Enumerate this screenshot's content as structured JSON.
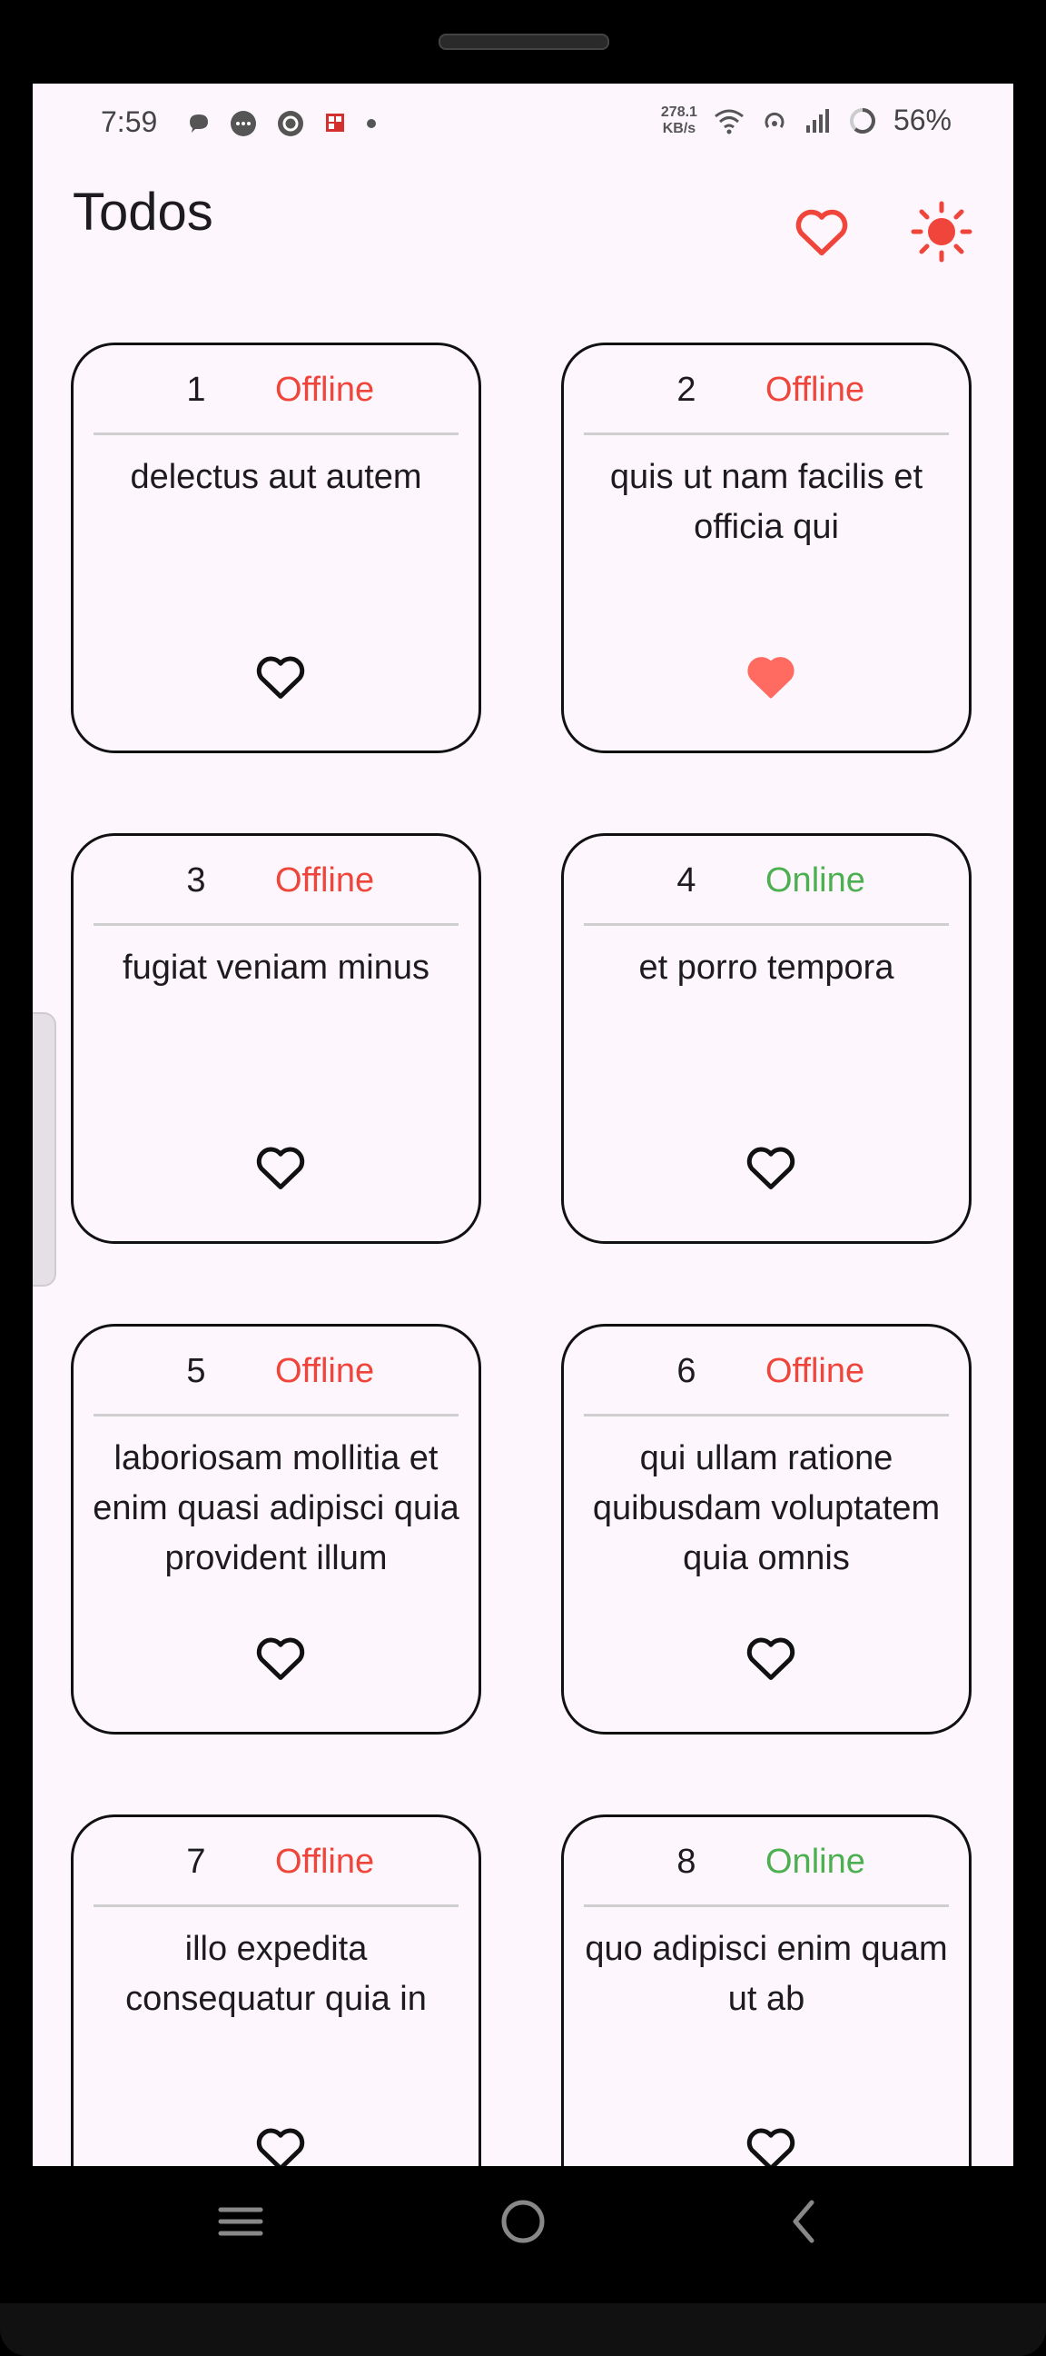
{
  "status_bar": {
    "time": "7:59",
    "network_speed_value": "278.1",
    "network_speed_unit": "KB/s",
    "battery": "56%"
  },
  "app_bar": {
    "title": "Todos",
    "favorites_icon": "heart-outline-icon",
    "theme_icon": "sun-icon"
  },
  "colors": {
    "accent": "#f0453a",
    "offline": "#f0453a",
    "online": "#4caf50",
    "favorite_fill": "#ff6b61",
    "background": "#fdf7fd"
  },
  "todos": [
    {
      "id": "1",
      "status": "Offline",
      "title": "delectus aut autem",
      "favorite": false
    },
    {
      "id": "2",
      "status": "Offline",
      "title": "quis ut nam facilis et officia qui",
      "favorite": true
    },
    {
      "id": "3",
      "status": "Offline",
      "title": "fugiat veniam minus",
      "favorite": false
    },
    {
      "id": "4",
      "status": "Online",
      "title": "et porro tempora",
      "favorite": false
    },
    {
      "id": "5",
      "status": "Offline",
      "title": "laboriosam mollitia et enim quasi adipisci quia provident illum",
      "favorite": false
    },
    {
      "id": "6",
      "status": "Offline",
      "title": "qui ullam ratione quibusdam voluptatem quia omnis",
      "favorite": false
    },
    {
      "id": "7",
      "status": "Offline",
      "title": "illo expedita consequatur quia in",
      "favorite": false
    },
    {
      "id": "8",
      "status": "Online",
      "title": "quo adipisci enim quam ut ab",
      "favorite": false
    }
  ],
  "nav_bar": {
    "recents_icon": "recents-icon",
    "home_icon": "home-icon",
    "back_icon": "back-icon"
  }
}
